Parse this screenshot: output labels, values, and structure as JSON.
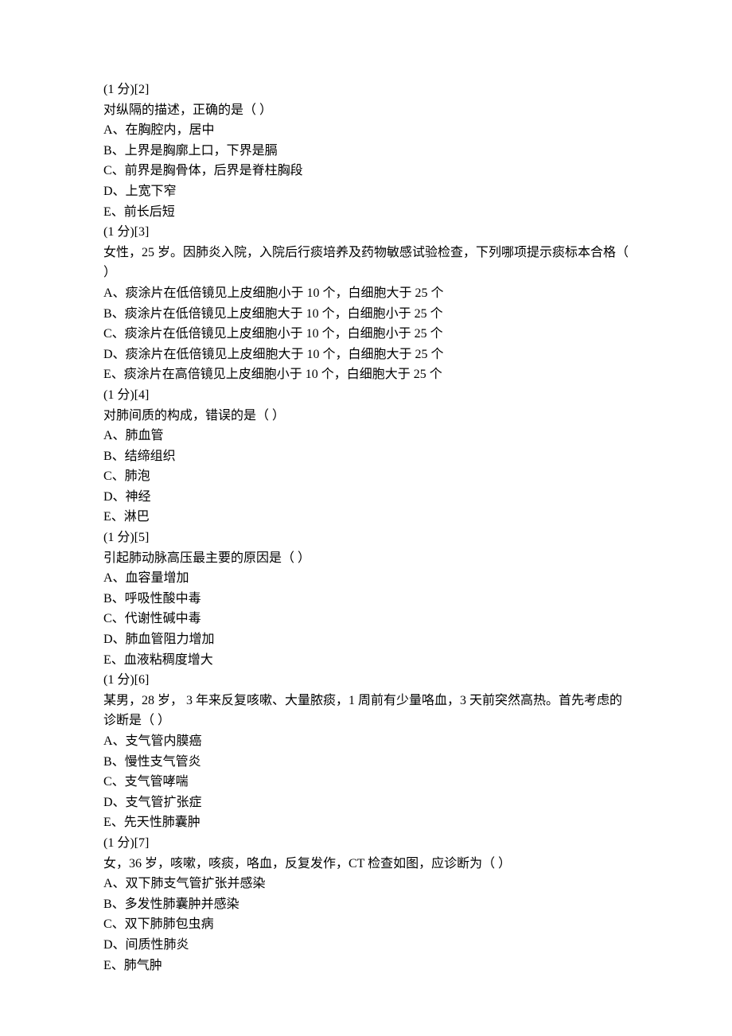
{
  "questions": [
    {
      "header": "(1 分)[2]",
      "stem": "对纵隔的描述，正确的是（  ）",
      "options": [
        "A、在胸腔内，居中",
        "B、上界是胸廓上口，下界是膈",
        "C、前界是胸骨体，后界是脊柱胸段",
        "D、上宽下窄",
        "E、前长后短"
      ]
    },
    {
      "header": "(1 分)[3]",
      "stem": "女性，25 岁。因肺炎入院，入院后行痰培养及药物敏感试验检查，下列哪项提示痰标本合格（  ）",
      "options": [
        "A、痰涂片在低倍镜见上皮细胞小于 10 个，白细胞大于 25 个",
        "B、痰涂片在低倍镜见上皮细胞大于 10 个，白细胞小于 25 个",
        "C、痰涂片在低倍镜见上皮细胞小于 10 个，白细胞小于 25 个",
        "D、痰涂片在低倍镜见上皮细胞大于 10 个，白细胞大于 25 个",
        "E、痰涂片在高倍镜见上皮细胞小于 10 个，白细胞大于 25 个"
      ]
    },
    {
      "header": "(1 分)[4]",
      "stem": "对肺间质的构成，错误的是（  ）",
      "options": [
        "A、肺血管",
        "B、结缔组织",
        "C、肺泡",
        "D、神经",
        "E、淋巴"
      ]
    },
    {
      "header": "(1 分)[5]",
      "stem": "引起肺动脉高压最主要的原因是（  ）",
      "options": [
        "A、血容量增加",
        "B、呼吸性酸中毒",
        "C、代谢性碱中毒",
        "D、肺血管阻力增加",
        "E、血液粘稠度增大"
      ]
    },
    {
      "header": "(1 分)[6]",
      "stem": "某男，28 岁， 3 年来反复咳嗽、大量脓痰，1 周前有少量咯血，3 天前突然高热。首先考虑的诊断是（  ）",
      "options": [
        "A、支气管内膜癌",
        "B、慢性支气管炎",
        "C、支气管哮喘",
        "D、支气管扩张症",
        "E、先天性肺囊肿"
      ]
    },
    {
      "header": "(1 分)[7]",
      "stem": "女，36 岁，咳嗽，咳痰，咯血，反复发作，CT 检查如图，应诊断为（  ）",
      "options": [
        "A、双下肺支气管扩张并感染",
        "B、多发性肺囊肿并感染",
        "C、双下肺肺包虫病",
        "D、间质性肺炎",
        "E、肺气肿"
      ]
    }
  ]
}
